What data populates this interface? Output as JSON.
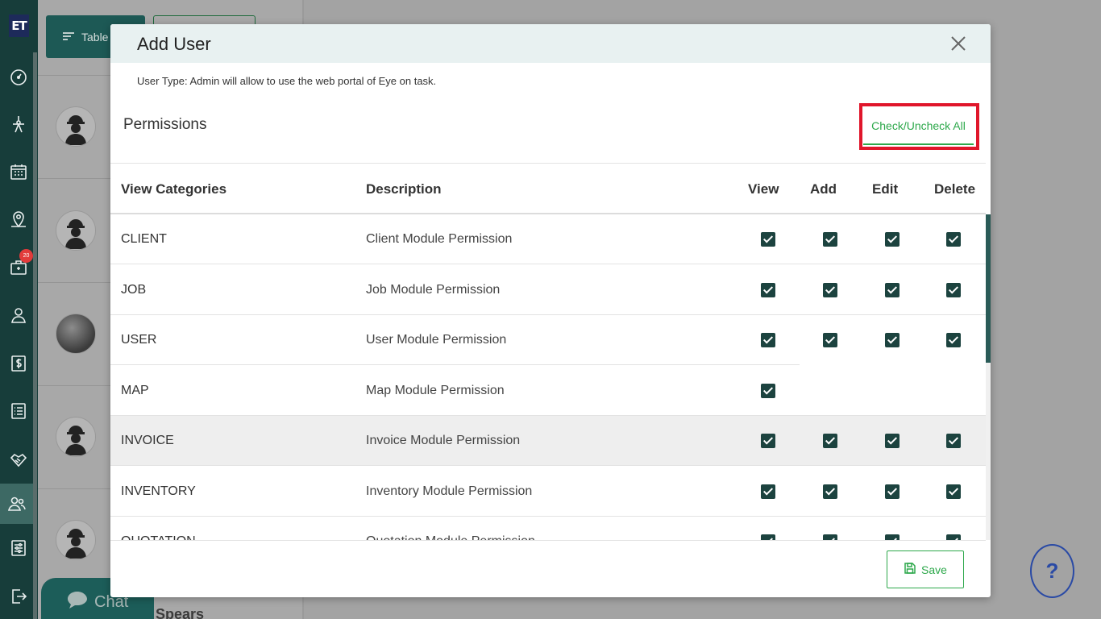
{
  "sidebar": {
    "logo": "ET",
    "badge_count": "20",
    "items": [
      {
        "icon": "dashboard-icon"
      },
      {
        "icon": "pen-tool-icon"
      },
      {
        "icon": "calendar-icon"
      },
      {
        "icon": "map-pin-icon"
      },
      {
        "icon": "briefcase-icon"
      },
      {
        "icon": "user-icon"
      },
      {
        "icon": "dollar-icon"
      },
      {
        "icon": "list-icon"
      },
      {
        "icon": "handshake-icon"
      },
      {
        "icon": "users-icon"
      },
      {
        "icon": "sliders-icon"
      },
      {
        "icon": "logout-icon"
      }
    ]
  },
  "background": {
    "table_view_label": "Table V",
    "chat_label": "Chat",
    "partial_name": "Spears",
    "help_label": "?"
  },
  "modal": {
    "title": "Add User",
    "user_type_note": "User Type: Admin will allow to use the web portal of Eye on task.",
    "permissions_title": "Permissions",
    "check_all_label": "Check/Uncheck All",
    "save_label": "Save",
    "columns": {
      "category": "View Categories",
      "description": "Description",
      "view": "View",
      "add": "Add",
      "edit": "Edit",
      "delete": "Delete"
    },
    "rows": [
      {
        "category": "CLIENT",
        "description": "Client Module Permission",
        "view": true,
        "add": true,
        "edit": true,
        "delete": true
      },
      {
        "category": "JOB",
        "description": "Job Module Permission",
        "view": true,
        "add": true,
        "edit": true,
        "delete": true
      },
      {
        "category": "USER",
        "description": "User Module Permission",
        "view": true,
        "add": true,
        "edit": true,
        "delete": true
      },
      {
        "category": "MAP",
        "description": "Map Module Permission",
        "view": true,
        "add": false,
        "edit": false,
        "delete": false
      },
      {
        "category": "INVOICE",
        "description": "Invoice Module Permission",
        "view": true,
        "add": true,
        "edit": true,
        "delete": true
      },
      {
        "category": "INVENTORY",
        "description": "Inventory Module Permission",
        "view": true,
        "add": true,
        "edit": true,
        "delete": true
      },
      {
        "category": "QUOTATION",
        "description": "Quotation Module Permission",
        "view": true,
        "add": true,
        "edit": true,
        "delete": true
      }
    ]
  },
  "colors": {
    "sidebar_bg": "#173d3a",
    "accent_green": "#2da84b",
    "checkbox": "#1c433f",
    "highlight_red": "#e0162b"
  }
}
